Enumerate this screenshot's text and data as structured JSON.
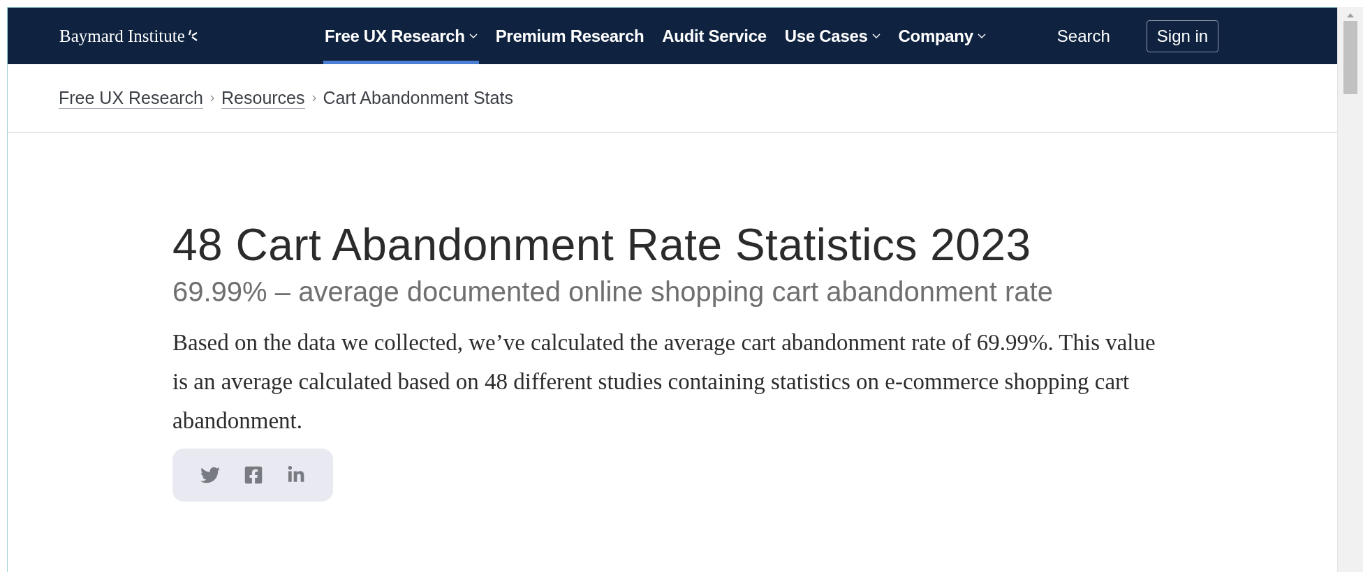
{
  "header": {
    "logo": "Baymard Institute",
    "nav": [
      {
        "label": "Free UX Research",
        "dropdown": true,
        "selected": true
      },
      {
        "label": "Premium Research",
        "dropdown": false,
        "selected": false
      },
      {
        "label": "Audit Service",
        "dropdown": false,
        "selected": false
      },
      {
        "label": "Use Cases",
        "dropdown": true,
        "selected": false
      },
      {
        "label": "Company",
        "dropdown": true,
        "selected": false
      }
    ],
    "search": "Search",
    "sign_in": "Sign in"
  },
  "breadcrumbs": [
    {
      "label": "Free UX Research",
      "link": true
    },
    {
      "label": "Resources",
      "link": true
    },
    {
      "label": "Cart Abandonment Stats",
      "link": false
    }
  ],
  "article": {
    "title": "48 Cart Abandonment Rate Statistics 2023",
    "subtitle": "69.99% – average documented online shopping cart abandonment rate",
    "body": "Based on the data we collected, we’ve calculated the average cart abandonment rate of 69.99%. This value is an average calculated based on 48 different studies containing statistics on e-commerce shopping cart abandonment.",
    "share": [
      {
        "kind": "twitter"
      },
      {
        "kind": "facebook"
      },
      {
        "kind": "linkedin"
      }
    ]
  }
}
